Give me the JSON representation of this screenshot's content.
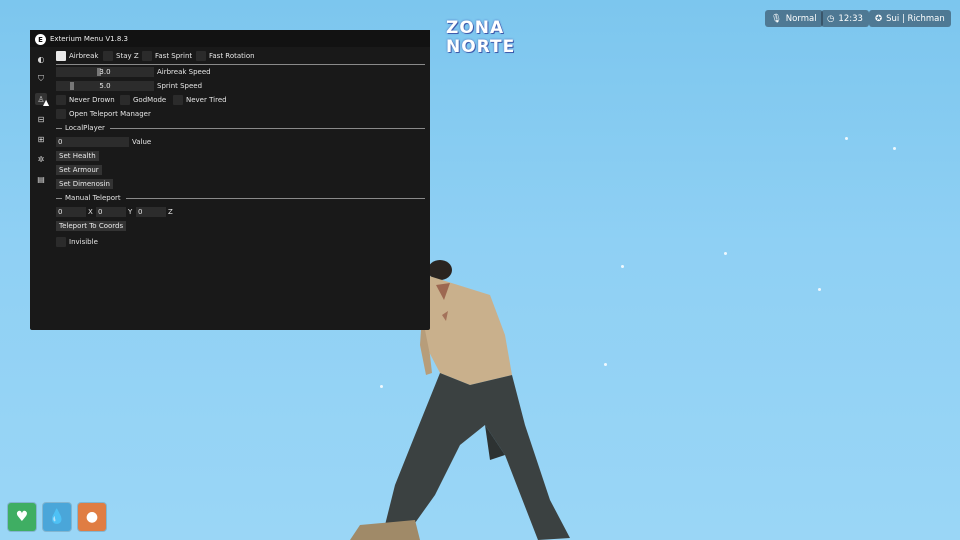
{
  "menu": {
    "title": "Exterium Menu V1.8.3",
    "airbreak": {
      "label": "Airbreak",
      "checked": true
    },
    "stay_z": {
      "label": "Stay Z"
    },
    "fast_sprint": {
      "label": "Fast Sprint"
    },
    "fast_rotation": {
      "label": "Fast Rotation"
    },
    "airbreak_speed": {
      "value": "3.0",
      "label": "Airbreak Speed"
    },
    "sprint_speed": {
      "value": "5.0",
      "label": "Sprint Speed"
    },
    "never_drown": {
      "label": "Never Drown"
    },
    "godmode": {
      "label": "GodMode"
    },
    "never_tired": {
      "label": "Never Tired"
    },
    "open_teleport": {
      "label": "Open Teleport Manager"
    },
    "section_local": "LocalPlayer",
    "value_input": "0",
    "value_label": "Value",
    "set_health": "Set Health",
    "set_armour": "Set Armour",
    "set_dimension": "Set Dimenosin",
    "section_teleport": "Manual Teleport",
    "coord_x": "0",
    "coord_y": "0",
    "coord_z": "0",
    "label_x": "X",
    "label_y": "Y",
    "label_z": "Z",
    "teleport_coords": "Teleport To Coords",
    "invisible": {
      "label": "Invisible"
    },
    "sidebar_icons": [
      "settings-icon",
      "shield-icon",
      "user-icon",
      "car-icon",
      "network-icon",
      "gear-icon",
      "building-icon"
    ]
  },
  "hud": {
    "voice": "Normal",
    "time": "12:33",
    "player": "Sui | Richman"
  },
  "logo": {
    "line1": "ZONA",
    "line2": "NORTE"
  },
  "status": [
    {
      "name": "health",
      "color": "#3fae63"
    },
    {
      "name": "water",
      "color": "#4aa6d9"
    },
    {
      "name": "food",
      "color": "#e07d43"
    }
  ]
}
